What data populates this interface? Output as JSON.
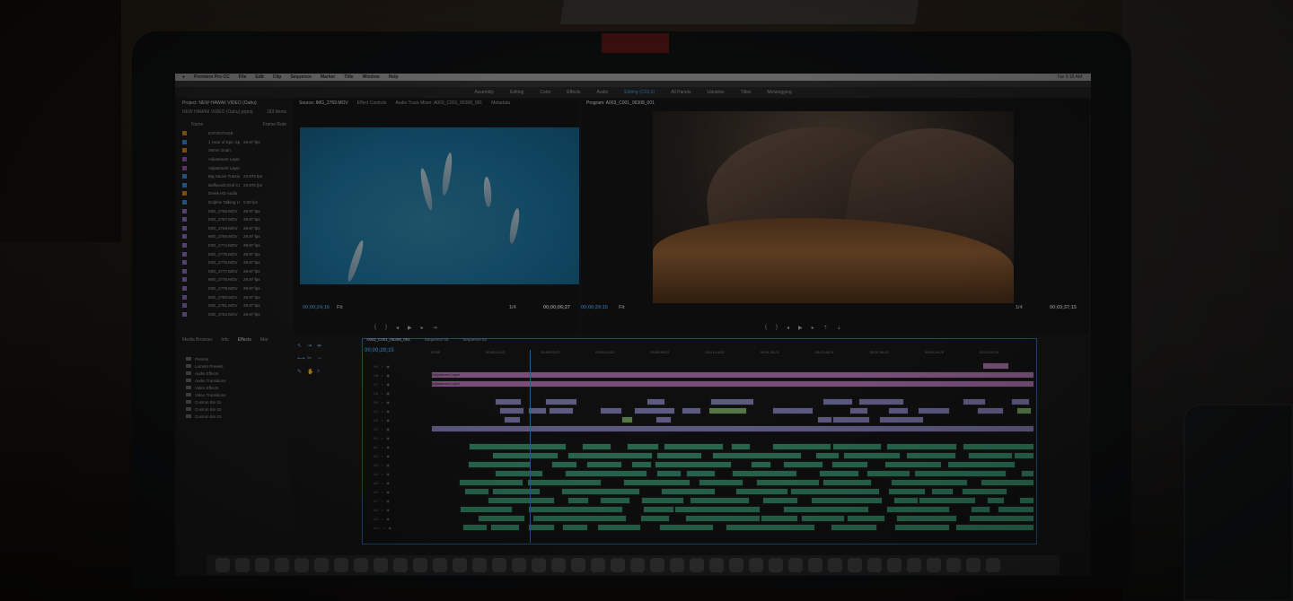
{
  "menubar": {
    "app": "Premiere Pro CC",
    "items": [
      "File",
      "Edit",
      "Clip",
      "Sequence",
      "Marker",
      "Title",
      "Window",
      "Help"
    ],
    "clock": "Tue 9:16 AM"
  },
  "workspaces": [
    "Assembly",
    "Editing",
    "Color",
    "Effects",
    "Audio",
    "Editing (CS5.5)",
    "All Panels",
    "Libraries",
    "Titles",
    "Metalogging"
  ],
  "project": {
    "title": "Project: NEW HAWAII VIDEO (Oahu)",
    "file": "NEW HAWAII VIDEO (Oahu).prproj",
    "item_count": "183 Items",
    "col_name": "Name",
    "col_fps": "Frame Rate",
    "items": [
      {
        "name": "EXFOOTAGE",
        "fps": "",
        "color": "#d8832b"
      },
      {
        "name": "1 Hour of Epic Space",
        "fps": "29.97 fps",
        "color": "#3d8fd9"
      },
      {
        "name": "35mm Grain",
        "fps": "",
        "color": "#d8832b"
      },
      {
        "name": "Adjustment Layer",
        "fps": "",
        "color": "#9b59b6"
      },
      {
        "name": "Adjustment Layer",
        "fps": "",
        "color": "#9b59b6"
      },
      {
        "name": "Big Sauce Tutorials.m",
        "fps": "23.976 fps",
        "color": "#3d8fd9"
      },
      {
        "name": "Buffwords End Card.th",
        "fps": "23.976 fps",
        "color": "#3d8fd9"
      },
      {
        "name": "Derek HD Audio",
        "fps": "",
        "color": "#d8832b"
      },
      {
        "name": "Dolphin Talking Unde",
        "fps": "0.00 fps",
        "color": "#3d8fd9"
      },
      {
        "name": "IMG_2765.MOV",
        "fps": "29.97 fps",
        "color": "#8e6fbf"
      },
      {
        "name": "IMG_2767.MOV",
        "fps": "29.97 fps",
        "color": "#8e6fbf"
      },
      {
        "name": "IMG_2768.MOV",
        "fps": "29.97 fps",
        "color": "#8e6fbf"
      },
      {
        "name": "IMG_2769.MOV",
        "fps": "29.97 fps",
        "color": "#8e6fbf"
      },
      {
        "name": "IMG_2774.MOV",
        "fps": "29.97 fps",
        "color": "#8e6fbf"
      },
      {
        "name": "IMG_2775.MOV",
        "fps": "29.97 fps",
        "color": "#8e6fbf"
      },
      {
        "name": "IMG_2776.MOV",
        "fps": "29.97 fps",
        "color": "#8e6fbf"
      },
      {
        "name": "IMG_2777.MOV",
        "fps": "29.97 fps",
        "color": "#8e6fbf"
      },
      {
        "name": "IMG_2778.MOV",
        "fps": "29.97 fps",
        "color": "#8e6fbf"
      },
      {
        "name": "IMG_2779.MOV",
        "fps": "29.97 fps",
        "color": "#8e6fbf"
      },
      {
        "name": "IMG_2780.MOV",
        "fps": "29.97 fps",
        "color": "#8e6fbf"
      },
      {
        "name": "IMG_2781.MOV",
        "fps": "29.97 fps",
        "color": "#8e6fbf"
      },
      {
        "name": "IMG_2782.MOV",
        "fps": "29.97 fps",
        "color": "#8e6fbf"
      }
    ]
  },
  "source": {
    "tabs": [
      "Source: IMG_2769.MOV",
      "Effect Controls",
      "Audio Track Mixer: A003_C001_06308_001",
      "Metadata"
    ],
    "timecode": "00;00;24;16",
    "fit": "Fit",
    "ratio": "1/4",
    "duration": "00;00;06;27"
  },
  "program": {
    "tab": "Program: A003_C001_06308_001",
    "timecode": "00;00;29;15",
    "fit": "Fit",
    "ratio": "1/4",
    "duration": "00;03;37;15"
  },
  "effects": {
    "tabs": [
      "Media Browser",
      "Info",
      "Effects",
      "Mar"
    ],
    "items": [
      "Presets",
      "Lumetri Presets",
      "Audio Effects",
      "Audio Transitions",
      "Video Effects",
      "Video Transitions",
      "Custom Bin 01",
      "Custom Bin 02",
      "Custom Bin 03"
    ]
  },
  "timeline": {
    "tabs": [
      "A003_C001_06308_001",
      "Sequence 03",
      "Sequence 03"
    ],
    "timecode": "00;00;29;15",
    "ruler": [
      "00;00",
      "00;00;14;23",
      "00;00;29;23",
      "00;00;44;22",
      "00;00;59;22",
      "00;01;14;22",
      "00;01;29;21",
      "00;01;44;21",
      "00;01;59;21",
      "00;02;14;20",
      "00;02;29;20"
    ],
    "video_tracks": [
      "V9",
      "V8",
      "V7",
      "V6",
      "V5",
      "V4",
      "V3",
      "V2",
      "V1"
    ],
    "audio_tracks": [
      "A1",
      "A2",
      "A3",
      "A4",
      "A5",
      "A6",
      "A7",
      "A8",
      "A9",
      "A10"
    ],
    "adjustment_label": "Adjustment Layer"
  }
}
